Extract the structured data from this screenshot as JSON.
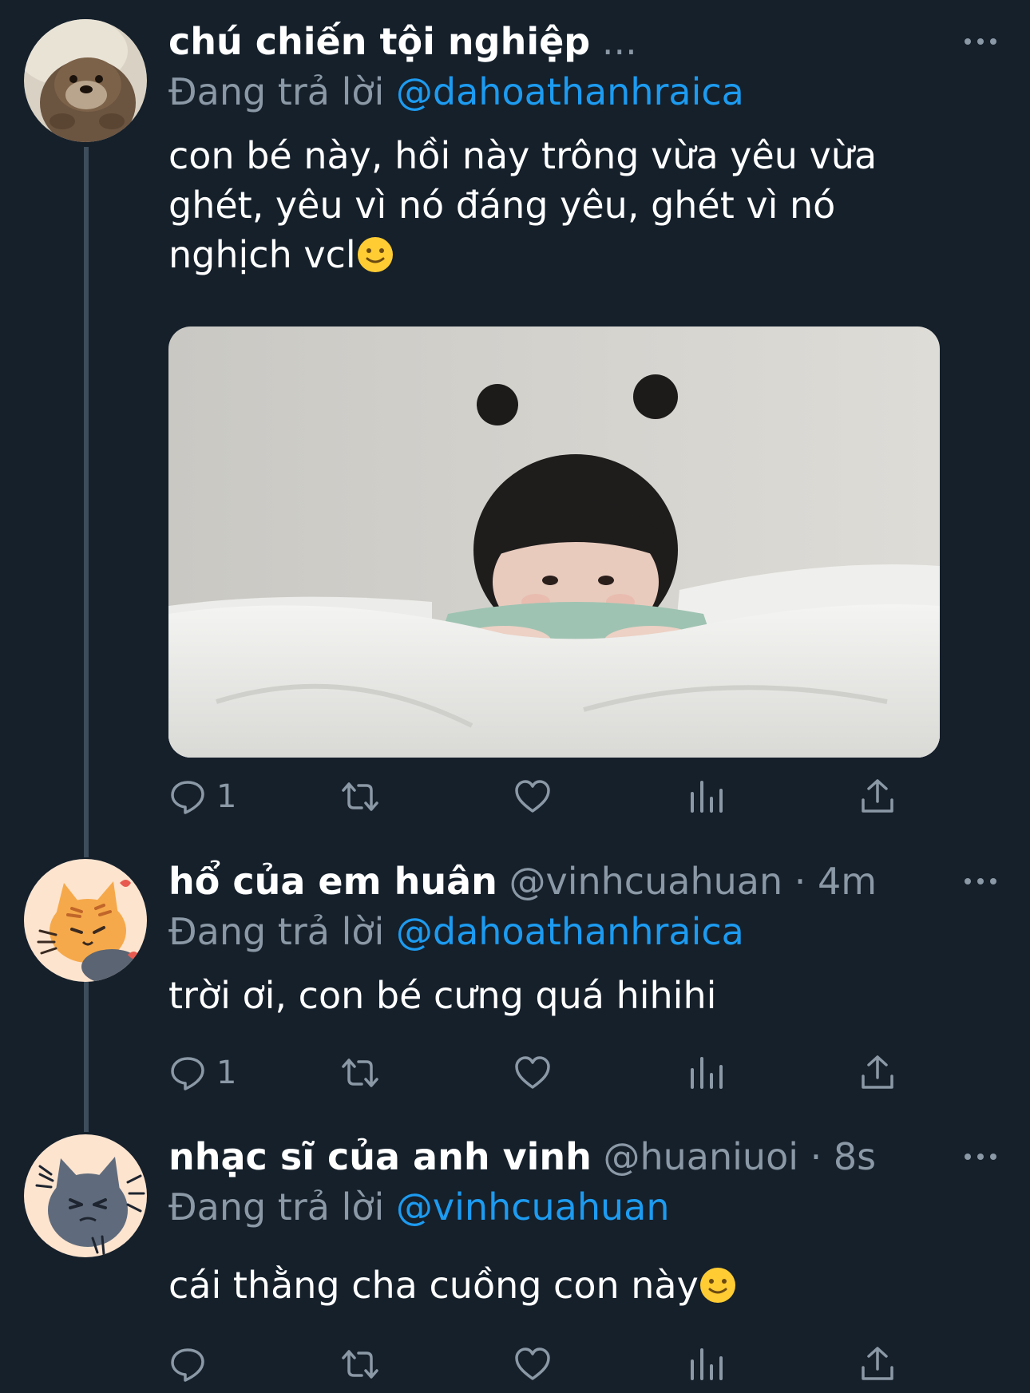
{
  "colors": {
    "background": "#15202b",
    "secondary_text": "#8b98a5",
    "mention": "#1d9bf0",
    "thread_line": "#3d4d5b"
  },
  "tweets": [
    {
      "display_name": "chú chiến tội nghiệp",
      "handle_meta": "...",
      "replying_prefix": "Đang trả lời",
      "replying_to": "@dahoathanhraica",
      "text": "con bé này, hồi này trông vừa yêu vừa ghét, yêu vì nó đáng yêu, ghét vì nó nghịch vcl",
      "has_emoji": true,
      "has_media": true,
      "media_description_icon": "photo-of-toddler-on-bed",
      "avatar_icon": "otter-avatar",
      "actions": {
        "reply_count": "1",
        "retweet_count": "",
        "like_count": "",
        "views_count": ""
      }
    },
    {
      "display_name": "hổ của em huân",
      "handle_meta": "@vinhcuahuan · 4m",
      "replying_prefix": "Đang trả lời",
      "replying_to": "@dahoathanhraica",
      "text": "trời ơi, con bé cưng quá hihihi",
      "has_emoji": false,
      "has_media": false,
      "avatar_icon": "orange-cat-avatar",
      "actions": {
        "reply_count": "1",
        "retweet_count": "",
        "like_count": "",
        "views_count": ""
      }
    },
    {
      "display_name": "nhạc sĩ của anh vinh",
      "handle_meta": "@huaniuoi · 8s",
      "replying_prefix": "Đang trả lời",
      "replying_to": "@vinhcuahuan",
      "text": "cái thằng cha cuồng con này",
      "has_emoji": true,
      "has_media": false,
      "avatar_icon": "grey-cat-avatar",
      "actions": {
        "reply_count": "",
        "retweet_count": "",
        "like_count": "",
        "views_count": ""
      }
    }
  ],
  "icons": {
    "reply": "reply-icon",
    "retweet": "retweet-icon",
    "like": "heart-icon",
    "views": "views-icon",
    "share": "share-icon",
    "more": "more-icon",
    "emoji": "slightly-smiling-face-emoji"
  }
}
